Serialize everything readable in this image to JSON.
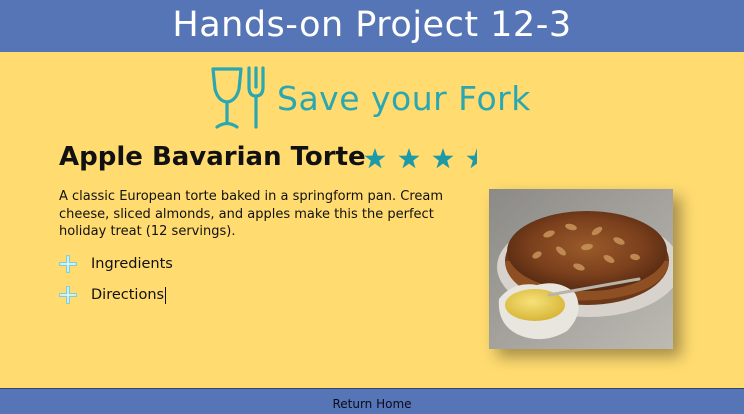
{
  "header": {
    "title": "Hands-on Project 12-3"
  },
  "logo": {
    "text": "Save your Fork",
    "icon": "wine-glass-and-fork-icon",
    "color": "#2aa7b0"
  },
  "recipe": {
    "title": "Apple Bavarian Torte",
    "rating": 3.5,
    "rating_max": 4,
    "description": "A classic European torte baked in a springform pan. Cream cheese, sliced almonds, and apples make this the perfect holiday treat (12 servings).",
    "sections": [
      {
        "label": "Ingredients",
        "icon": "plus-icon"
      },
      {
        "label": "Directions",
        "icon": "plus-icon"
      }
    ],
    "image": "apple-torte-photo"
  },
  "footer": {
    "link": "Return Home"
  },
  "colors": {
    "background": "#ffdb70",
    "bar": "#5675b6",
    "accent": "#2aa7b0"
  }
}
